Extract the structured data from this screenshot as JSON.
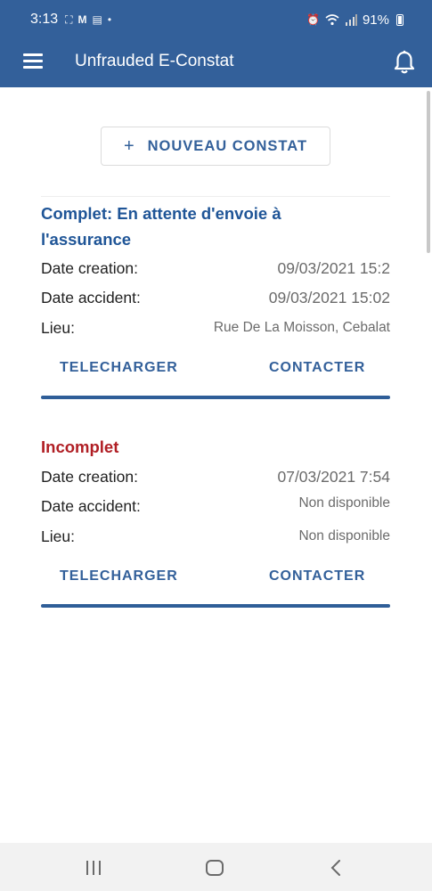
{
  "status_bar": {
    "time": "3:13",
    "battery": "91%"
  },
  "app_bar": {
    "title": "Unfrauded E-Constat"
  },
  "new_button": {
    "plus": "+",
    "label": "NOUVEAU CONSTAT"
  },
  "constats": [
    {
      "status_line1": "Complet: En attente d'envoie à",
      "status_line2": "l'assurance",
      "status_color": "#1f5597",
      "creation_label": "Date creation:",
      "creation_value": "09/03/2021 15:2",
      "accident_label": "Date accident:",
      "accident_value": "09/03/2021 15:02",
      "lieu_label": "Lieu:",
      "lieu_value": "Rue De La Moisson, Cebalat",
      "download_label": "TELECHARGER",
      "contact_label": "CONTACTER"
    },
    {
      "status_line1": "Incomplet",
      "status_color": "#b01e24",
      "creation_label": "Date creation:",
      "creation_value": "07/03/2021 7:54",
      "accident_label": "Date accident:",
      "accident_value": "Non disponible",
      "lieu_label": "Lieu:",
      "lieu_value": "Non disponible",
      "download_label": "TELECHARGER",
      "contact_label": "CONTACTER"
    }
  ],
  "colors": {
    "primary": "#33609a",
    "status_complete": "#1f5597",
    "status_incomplete": "#b01e24"
  },
  "icons": [
    "menu-icon",
    "bell-icon",
    "recent-apps-icon",
    "home-icon",
    "back-icon"
  ]
}
